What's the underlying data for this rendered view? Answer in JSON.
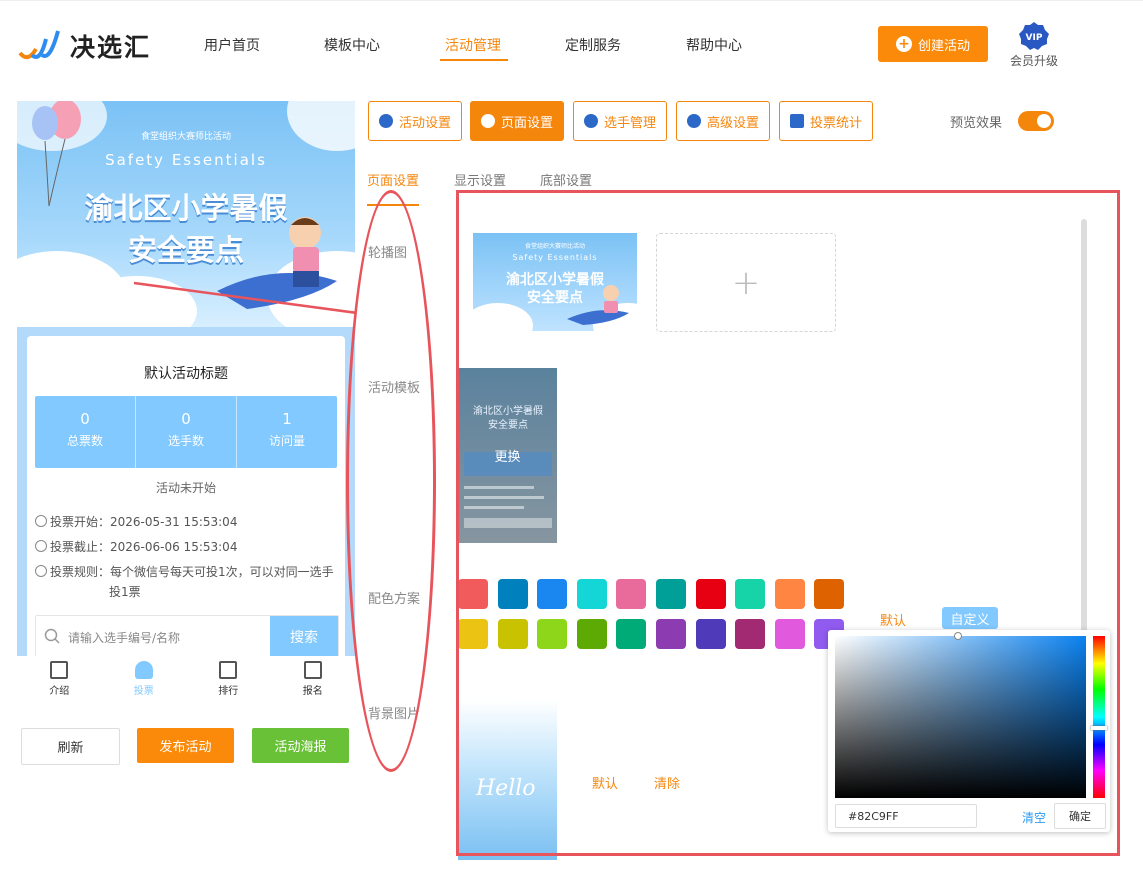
{
  "header": {
    "brand": "决选汇",
    "nav": [
      {
        "label": "用户首页",
        "active": false
      },
      {
        "label": "模板中心",
        "active": false
      },
      {
        "label": "活动管理",
        "active": true
      },
      {
        "label": "定制服务",
        "active": false
      },
      {
        "label": "帮助中心",
        "active": false
      }
    ],
    "create_button": "创建活动",
    "vip_badge": "VIP",
    "vip_label": "会员升级"
  },
  "preview": {
    "banner": {
      "small_title": "食堂组织大赛师比活动",
      "english_title": "Safety  Essentials",
      "title_line1": "渝北区小学暑假",
      "title_line2": "安全要点"
    },
    "activity_title": "默认活动标题",
    "stats": [
      {
        "value": "0",
        "label": "总票数"
      },
      {
        "value": "0",
        "label": "选手数"
      },
      {
        "value": "1",
        "label": "访问量"
      }
    ],
    "status": "活动未开始",
    "vote_start": "投票开始：2026-05-31 15:53:04",
    "vote_end": "投票截止：2026-06-06 15:53:04",
    "vote_rule": "投票规则：每个微信号每天可投1次，可以对同一选手",
    "vote_rule_cont": "投1票",
    "search_placeholder": "请输入选手编号/名称",
    "search_button": "搜索",
    "tabs": [
      {
        "label": "介绍",
        "icon": "document-icon",
        "active": false
      },
      {
        "label": "投票",
        "icon": "user-icon",
        "active": true
      },
      {
        "label": "排行",
        "icon": "chart-icon",
        "active": false
      },
      {
        "label": "报名",
        "icon": "id-card-icon",
        "active": false
      }
    ]
  },
  "bottom_buttons": {
    "refresh": "刷新",
    "publish": "发布活动",
    "poster": "活动海报"
  },
  "toolbar": {
    "items": [
      {
        "label": "活动设置",
        "icon": "star-icon",
        "active": false
      },
      {
        "label": "页面设置",
        "icon": "gear-icon",
        "active": true
      },
      {
        "label": "选手管理",
        "icon": "users-icon",
        "active": false
      },
      {
        "label": "高级设置",
        "icon": "settings-icon",
        "active": false
      },
      {
        "label": "投票统计",
        "icon": "bar-chart-icon",
        "active": false
      }
    ],
    "preview_label": "预览效果",
    "preview_on": true
  },
  "subtabs": [
    {
      "label": "页面设置",
      "active": true
    },
    {
      "label": "显示设置",
      "active": false
    },
    {
      "label": "底部设置",
      "active": false
    }
  ],
  "form": {
    "carousel_label": "轮播图",
    "carousel_thumb": {
      "small_title": "食堂组织大赛师比活动",
      "english_title": "Safety  Essentials",
      "title_line1": "渝北区小学暑假",
      "title_line2": "安全要点"
    },
    "upload_plus": "+",
    "template_label": "活动模板",
    "template_change": "更换",
    "color_label": "配色方案",
    "colors": [
      "#f25b5b",
      "#0081be",
      "#1a86ef",
      "#14d6d6",
      "#e86b9b",
      "#00a098",
      "#e60012",
      "#17d3a8",
      "#ff8542",
      "#de6200",
      "#ebc313",
      "#c9c200",
      "#8ed61a",
      "#5eaa05",
      "#00ab78",
      "#8c3bb0",
      "#4f3bba",
      "#a12a73",
      "#e15ade",
      "#915bf0"
    ],
    "color_default": "默认",
    "color_custom": "自定义",
    "bg_label": "背景图片",
    "bg_text": "Hello",
    "bg_default": "默认",
    "bg_clear": "清除"
  },
  "color_picker": {
    "hex_value": "#82C9FF",
    "clear": "清空",
    "confirm": "确定"
  }
}
